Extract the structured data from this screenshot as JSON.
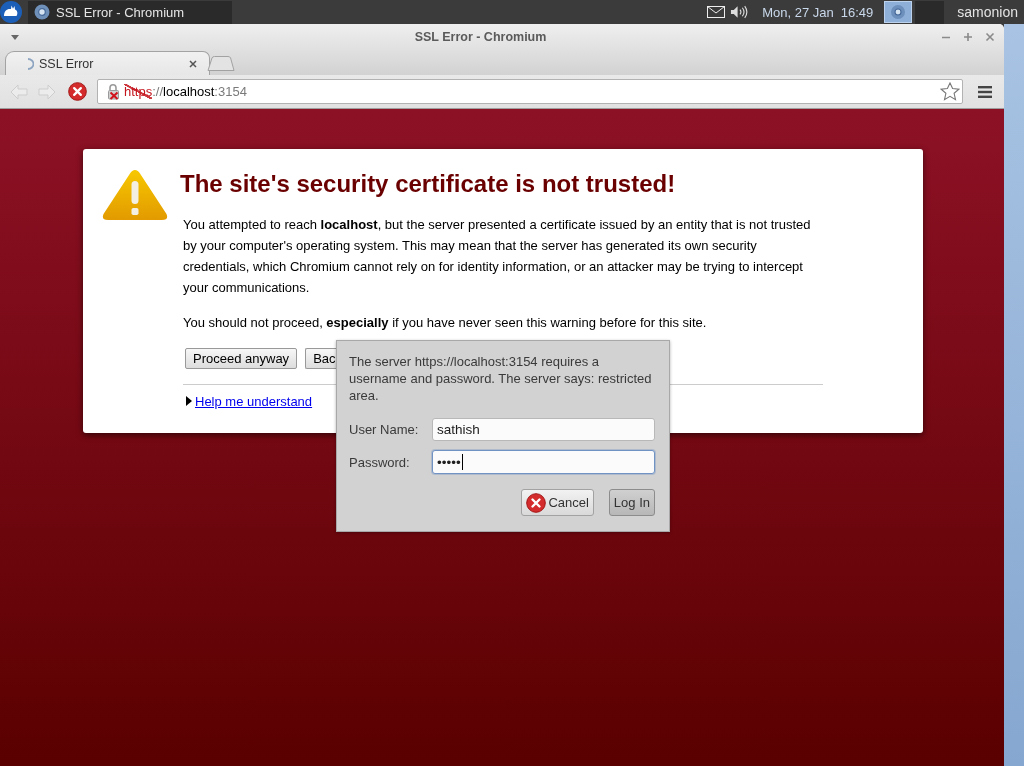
{
  "top_panel": {
    "taskbar_items": [
      {
        "label": "SSL Error - Chromium",
        "selected": true
      }
    ],
    "date": "Mon, 27 Jan",
    "time": "16:49",
    "user": "samonion"
  },
  "window": {
    "title": "SSL Error - Chromium"
  },
  "tabs": [
    {
      "label": "SSL Error",
      "selected": true,
      "loading": true
    }
  ],
  "toolbar": {
    "navigation": [
      {
        "kind": "back",
        "disabled": true
      },
      {
        "kind": "forward",
        "disabled": true
      },
      {
        "kind": "stop",
        "disabled": false
      }
    ],
    "address_bar": {
      "scheme": "https",
      "separator": "://",
      "host": "localhost",
      "port": ":3154",
      "certificate_error": true
    }
  },
  "interstitial": {
    "heading": "The site's security certificate is not trusted!",
    "paragraphs": [
      "You attempted to reach **localhost**, but the server presented a certificate issued by an entity that is not trusted by your computer's operating system. This may mean that the server has generated its own security credentials, which Chromium cannot rely on for identity information, or an attacker may be trying to intercept your communications.",
      "You should not proceed, **especially** if you have never seen this warning before for this site."
    ],
    "buttons": [
      {
        "label": "Proceed anyway",
        "covered": false
      },
      {
        "label": "Bac",
        "covered": true
      }
    ],
    "details_link": {
      "label": "Help me understand",
      "expanded": false
    }
  },
  "auth_dialog": {
    "message": "The server https://localhost:3154 requires a username and password. The server says: restricted area.",
    "fields": [
      {
        "label": "User Name:",
        "value": "sathish",
        "focused": false
      },
      {
        "label": "Password:",
        "value": "•••••",
        "focused": true
      }
    ],
    "buttons": [
      {
        "label": "Cancel",
        "kind": "cancel"
      },
      {
        "label": "Log In",
        "kind": "default"
      }
    ]
  }
}
